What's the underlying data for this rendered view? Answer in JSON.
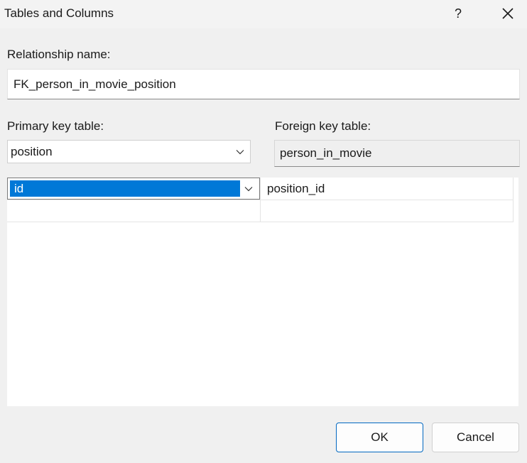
{
  "dialog": {
    "title": "Tables and Columns",
    "help_icon": "question-mark-icon",
    "close_icon": "close-icon"
  },
  "relationship": {
    "label": "Relationship name:",
    "value": "FK_person_in_movie_position"
  },
  "primary_key": {
    "label": "Primary key table:",
    "value": "position"
  },
  "foreign_key": {
    "label": "Foreign key table:",
    "value": "person_in_movie"
  },
  "columns": {
    "rows": [
      {
        "primary": "id",
        "foreign": "position_id"
      },
      {
        "primary": "",
        "foreign": ""
      }
    ]
  },
  "buttons": {
    "ok": "OK",
    "cancel": "Cancel"
  },
  "colors": {
    "selection": "#0078d7",
    "default_button_border": "#0067c0"
  }
}
